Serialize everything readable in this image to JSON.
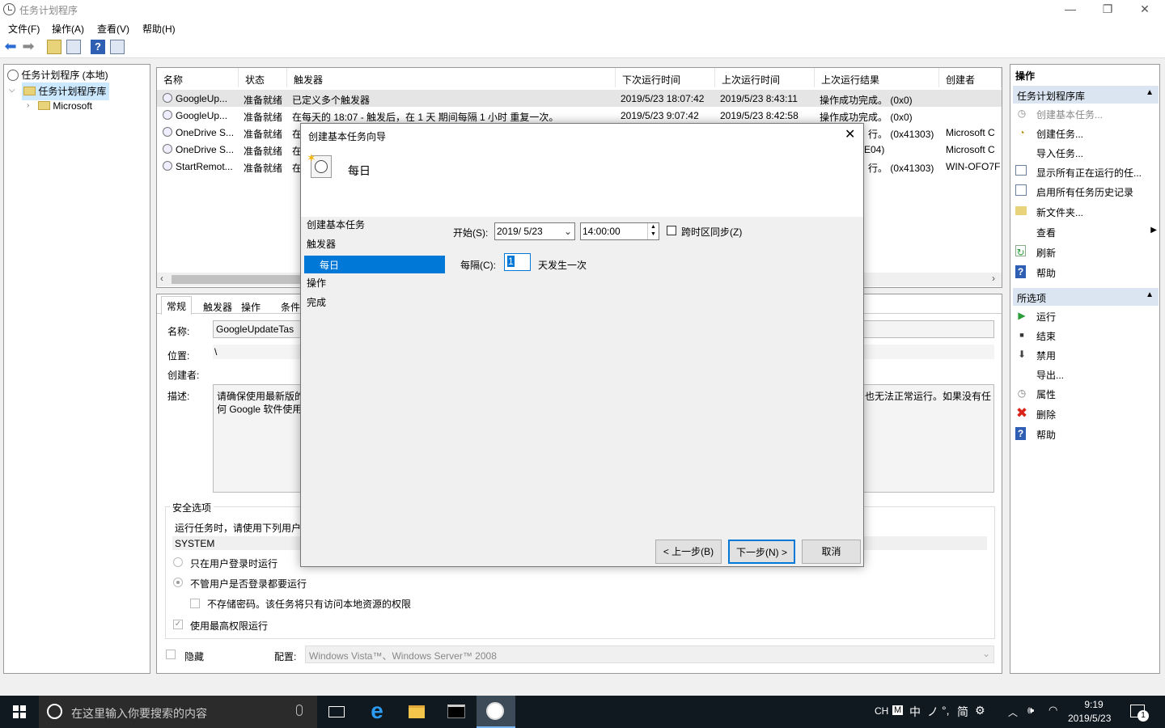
{
  "window": {
    "title": "任务计划程序",
    "minimize": "—",
    "restore": "❐",
    "close": "✕"
  },
  "menubar": [
    "文件(F)",
    "操作(A)",
    "查看(V)",
    "帮助(H)"
  ],
  "tree": {
    "root": "任务计划程序 (本地)",
    "library": "任务计划程序库",
    "child": "Microsoft"
  },
  "table": {
    "headers": [
      "名称",
      "状态",
      "触发器",
      "下次运行时间",
      "上次运行时间",
      "上次运行结果",
      "创建者"
    ],
    "rows": [
      {
        "name": "GoogleUp...",
        "status": "准备就绪",
        "trigger": "已定义多个触发器",
        "next": "2019/5/23 18:07:42",
        "last": "2019/5/23 8:43:11",
        "result": "操作成功完成。 (0x0)",
        "author": ""
      },
      {
        "name": "GoogleUp...",
        "status": "准备就绪",
        "trigger": "在每天的 18:07 - 触发后，在 1 天 期间每隔 1 小时 重复一次。",
        "next": "2019/5/23 9:07:42",
        "last": "2019/5/23 8:42:58",
        "result": "操作成功完成。 (0x0)",
        "author": ""
      },
      {
        "name": "OneDrive S...",
        "status": "准备就绪",
        "trigger": "在",
        "next": "",
        "last": "",
        "result": "行。 (0x41303)",
        "author": "Microsoft C"
      },
      {
        "name": "OneDrive S...",
        "status": "准备就绪",
        "trigger": "在",
        "next": "",
        "last": "",
        "result": "E04)",
        "author": "Microsoft C"
      },
      {
        "name": "StartRemot...",
        "status": "准备就绪",
        "trigger": "在",
        "next": "",
        "last": "",
        "result": "行。 (0x41303)",
        "author": "WIN-OFO7F"
      }
    ]
  },
  "details": {
    "tabs": [
      "常规",
      "触发器",
      "操作",
      "条件"
    ],
    "name_label": "名称:",
    "name_value": "GoogleUpdateTas",
    "location_label": "位置:",
    "location_value": "\\",
    "author_label": "创建者:",
    "desc_label": "描述:",
    "desc_line1": "请确保使用最新版的",
    "desc_line2": "何 Google 软件使用",
    "desc_right": "也无法正常运行。如果没有任",
    "security_title": "安全选项",
    "run_as_text": "运行任务时，请使用下列用户",
    "user": "SYSTEM",
    "opt1": "只在用户登录时运行",
    "opt2": "不管用户是否登录都要运行",
    "opt3": "不存储密码。该任务将只有访问本地资源的权限",
    "opt4": "使用最高权限运行",
    "hidden": "隐藏",
    "config_label": "配置:",
    "config_value": "Windows Vista™、Windows Server™ 2008"
  },
  "actions": {
    "header": "操作",
    "section1": "任务计划程序库",
    "items1": [
      "创建基本任务...",
      "创建任务...",
      "导入任务...",
      "显示所有正在运行的任...",
      "启用所有任务历史记录",
      "新文件夹...",
      "查看",
      "刷新",
      "帮助"
    ],
    "section2": "所选项",
    "items2": [
      "运行",
      "结束",
      "禁用",
      "导出...",
      "属性",
      "删除",
      "帮助"
    ]
  },
  "dialog": {
    "title": "创建基本任务向导",
    "heading": "每日",
    "steps": [
      "创建基本任务",
      "触发器",
      "每日",
      "操作",
      "完成"
    ],
    "start_label": "开始(S):",
    "start_date": "2019/  5/23",
    "start_time": "14:00:00",
    "sync_label": "跨时区同步(Z)",
    "every_label": "每隔(C):",
    "every_value": "1",
    "every_suffix": "天发生一次",
    "back": "< 上一步(B)",
    "next": "下一步(N) >",
    "cancel": "取消"
  },
  "taskbar": {
    "search_placeholder": "在这里输入你要搜索的内容",
    "time": "9:19",
    "date": "2019/5/23",
    "ime": [
      "CH",
      "M",
      "中",
      "ノ",
      "°,",
      "简",
      "⚙"
    ],
    "notifications": "1"
  },
  "colors": {
    "selection": "#0078d7",
    "section_header": "#dbe5f1"
  }
}
